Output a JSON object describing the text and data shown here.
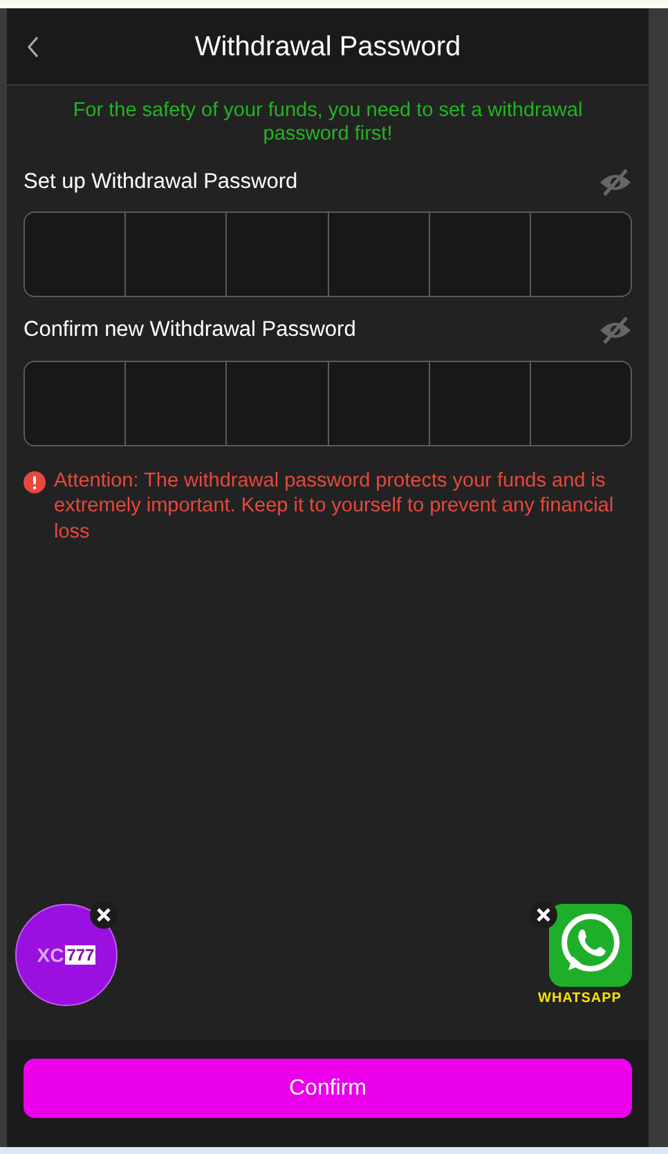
{
  "header": {
    "title": "Withdrawal Password"
  },
  "notice": "For the safety of your funds, you need to set a withdrawal password first!",
  "password_fields": [
    {
      "label": "Set up Withdrawal Password",
      "visible": false
    },
    {
      "label": "Confirm new Withdrawal Password",
      "visible": false
    }
  ],
  "warning": "Attention: The withdrawal password protects your funds and is extremely important. Keep it to yourself to prevent any financial loss",
  "floating_buttons": [
    {
      "kind": "promo",
      "logo_prefix": "XC",
      "logo_digits": "777"
    },
    {
      "kind": "whatsapp",
      "caption": "WHATSAPP"
    }
  ],
  "confirm_button": "Confirm"
}
